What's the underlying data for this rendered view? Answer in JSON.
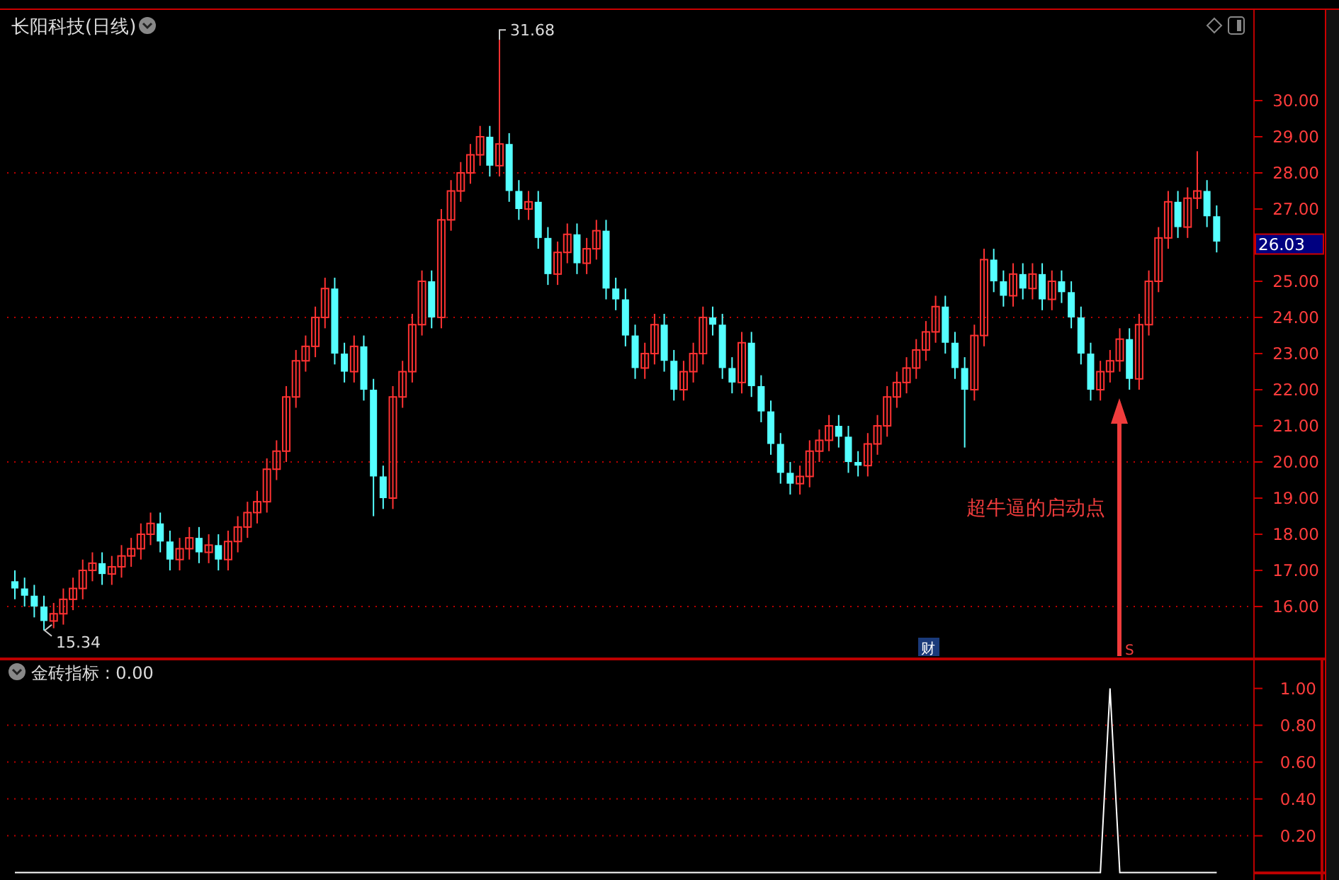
{
  "chart_title": "长阳科技(日线)",
  "chart_data": {
    "type": "candlestick",
    "ohlc": [
      [
        16.7,
        17.0,
        16.2,
        16.5
      ],
      [
        16.5,
        16.8,
        16.0,
        16.3
      ],
      [
        16.3,
        16.6,
        15.7,
        16.0
      ],
      [
        16.0,
        16.3,
        15.34,
        15.6
      ],
      [
        15.6,
        16.1,
        15.4,
        15.8
      ],
      [
        15.8,
        16.5,
        15.5,
        16.2
      ],
      [
        16.2,
        16.8,
        15.9,
        16.5
      ],
      [
        16.5,
        17.3,
        16.2,
        17.0
      ],
      [
        17.0,
        17.5,
        16.7,
        17.2
      ],
      [
        17.2,
        17.5,
        16.6,
        16.9
      ],
      [
        16.9,
        17.4,
        16.6,
        17.1
      ],
      [
        17.1,
        17.7,
        16.8,
        17.4
      ],
      [
        17.4,
        17.9,
        17.1,
        17.6
      ],
      [
        17.6,
        18.3,
        17.3,
        18.0
      ],
      [
        18.0,
        18.6,
        17.7,
        18.3
      ],
      [
        18.3,
        18.6,
        17.5,
        17.8
      ],
      [
        17.8,
        18.1,
        17.0,
        17.3
      ],
      [
        17.3,
        17.9,
        17.0,
        17.6
      ],
      [
        17.6,
        18.2,
        17.3,
        17.9
      ],
      [
        17.9,
        18.2,
        17.2,
        17.5
      ],
      [
        17.5,
        18.0,
        17.2,
        17.7
      ],
      [
        17.7,
        18.0,
        17.0,
        17.3
      ],
      [
        17.3,
        18.1,
        17.0,
        17.8
      ],
      [
        17.8,
        18.5,
        17.5,
        18.2
      ],
      [
        18.2,
        18.9,
        17.9,
        18.6
      ],
      [
        18.6,
        19.2,
        18.3,
        18.9
      ],
      [
        18.9,
        20.1,
        18.6,
        19.8
      ],
      [
        19.8,
        20.6,
        19.5,
        20.3
      ],
      [
        20.3,
        22.1,
        20.0,
        21.8
      ],
      [
        21.8,
        23.1,
        21.5,
        22.8
      ],
      [
        22.8,
        23.5,
        22.5,
        23.2
      ],
      [
        23.2,
        24.3,
        22.9,
        24.0
      ],
      [
        24.0,
        25.1,
        23.7,
        24.8
      ],
      [
        24.8,
        25.1,
        22.7,
        23.0
      ],
      [
        23.0,
        23.3,
        22.2,
        22.5
      ],
      [
        22.5,
        23.5,
        22.2,
        23.2
      ],
      [
        23.2,
        23.5,
        21.7,
        22.0
      ],
      [
        22.0,
        22.3,
        18.5,
        19.6
      ],
      [
        19.6,
        19.9,
        18.7,
        19.0
      ],
      [
        19.0,
        22.1,
        18.7,
        21.8
      ],
      [
        21.8,
        22.8,
        21.5,
        22.5
      ],
      [
        22.5,
        24.1,
        22.2,
        23.8
      ],
      [
        23.8,
        25.3,
        23.5,
        25.0
      ],
      [
        25.0,
        25.3,
        23.7,
        24.0
      ],
      [
        24.0,
        27.0,
        23.7,
        26.7
      ],
      [
        26.7,
        27.8,
        26.4,
        27.5
      ],
      [
        27.5,
        28.3,
        27.2,
        28.0
      ],
      [
        28.0,
        28.8,
        27.7,
        28.5
      ],
      [
        28.5,
        29.3,
        28.2,
        29.0
      ],
      [
        29.0,
        29.3,
        27.9,
        28.2
      ],
      [
        28.2,
        31.68,
        27.9,
        28.8
      ],
      [
        28.8,
        29.1,
        27.2,
        27.5
      ],
      [
        27.5,
        27.8,
        26.7,
        27.0
      ],
      [
        27.0,
        27.5,
        26.7,
        27.2
      ],
      [
        27.2,
        27.5,
        25.9,
        26.2
      ],
      [
        26.2,
        26.5,
        24.9,
        25.2
      ],
      [
        25.2,
        26.1,
        24.9,
        25.8
      ],
      [
        25.8,
        26.6,
        25.5,
        26.3
      ],
      [
        26.3,
        26.6,
        25.2,
        25.5
      ],
      [
        25.5,
        26.2,
        25.2,
        25.9
      ],
      [
        25.9,
        26.7,
        25.6,
        26.4
      ],
      [
        26.4,
        26.7,
        24.5,
        24.8
      ],
      [
        24.8,
        25.1,
        24.2,
        24.5
      ],
      [
        24.5,
        24.8,
        23.2,
        23.5
      ],
      [
        23.5,
        23.8,
        22.3,
        22.6
      ],
      [
        22.6,
        23.3,
        22.3,
        23.0
      ],
      [
        23.0,
        24.1,
        22.7,
        23.8
      ],
      [
        23.8,
        24.1,
        22.5,
        22.8
      ],
      [
        22.8,
        23.1,
        21.7,
        22.0
      ],
      [
        22.0,
        22.8,
        21.7,
        22.5
      ],
      [
        22.5,
        23.3,
        22.2,
        23.0
      ],
      [
        23.0,
        24.3,
        22.7,
        24.0
      ],
      [
        24.0,
        24.3,
        23.5,
        23.8
      ],
      [
        23.8,
        24.1,
        22.3,
        22.6
      ],
      [
        22.6,
        22.9,
        21.9,
        22.2
      ],
      [
        22.2,
        23.6,
        21.9,
        23.3
      ],
      [
        23.3,
        23.6,
        21.8,
        22.1
      ],
      [
        22.1,
        22.4,
        21.1,
        21.4
      ],
      [
        21.4,
        21.7,
        20.2,
        20.5
      ],
      [
        20.5,
        20.8,
        19.4,
        19.7
      ],
      [
        19.7,
        20.0,
        19.1,
        19.4
      ],
      [
        19.4,
        19.9,
        19.1,
        19.6
      ],
      [
        19.6,
        20.6,
        19.3,
        20.3
      ],
      [
        20.3,
        20.9,
        20.0,
        20.6
      ],
      [
        20.6,
        21.3,
        20.3,
        21.0
      ],
      [
        21.0,
        21.3,
        20.4,
        20.7
      ],
      [
        20.7,
        21.0,
        19.7,
        20.0
      ],
      [
        20.0,
        20.3,
        19.6,
        19.9
      ],
      [
        19.9,
        20.8,
        19.6,
        20.5
      ],
      [
        20.5,
        21.3,
        20.2,
        21.0
      ],
      [
        21.0,
        22.1,
        20.7,
        21.8
      ],
      [
        21.8,
        22.5,
        21.5,
        22.2
      ],
      [
        22.2,
        22.9,
        21.9,
        22.6
      ],
      [
        22.6,
        23.4,
        22.3,
        23.1
      ],
      [
        23.1,
        23.9,
        22.8,
        23.6
      ],
      [
        23.6,
        24.6,
        23.3,
        24.3
      ],
      [
        24.3,
        24.6,
        23.0,
        23.3
      ],
      [
        23.3,
        23.6,
        22.3,
        22.6
      ],
      [
        22.6,
        22.9,
        20.4,
        22.0
      ],
      [
        22.0,
        23.8,
        21.7,
        23.5
      ],
      [
        23.5,
        25.9,
        23.2,
        25.6
      ],
      [
        25.6,
        25.9,
        24.7,
        25.0
      ],
      [
        25.0,
        25.3,
        24.3,
        24.6
      ],
      [
        24.6,
        25.5,
        24.3,
        25.2
      ],
      [
        25.2,
        25.5,
        24.5,
        24.8
      ],
      [
        24.8,
        25.5,
        24.5,
        25.2
      ],
      [
        25.2,
        25.5,
        24.2,
        24.5
      ],
      [
        24.5,
        25.3,
        24.2,
        25.0
      ],
      [
        25.0,
        25.3,
        24.4,
        24.7
      ],
      [
        24.7,
        25.0,
        23.7,
        24.0
      ],
      [
        24.0,
        24.3,
        22.7,
        23.0
      ],
      [
        23.0,
        23.3,
        21.7,
        22.0
      ],
      [
        22.0,
        22.8,
        21.7,
        22.5
      ],
      [
        22.5,
        23.1,
        22.2,
        22.8
      ],
      [
        22.8,
        23.7,
        22.5,
        23.4
      ],
      [
        23.4,
        23.7,
        22.0,
        22.3
      ],
      [
        22.3,
        24.1,
        22.0,
        23.8
      ],
      [
        23.8,
        25.3,
        23.5,
        25.0
      ],
      [
        25.0,
        26.5,
        24.7,
        26.2
      ],
      [
        26.2,
        27.5,
        25.9,
        27.2
      ],
      [
        27.2,
        27.5,
        26.2,
        26.5
      ],
      [
        26.5,
        27.6,
        26.2,
        27.3
      ],
      [
        27.3,
        28.6,
        27.0,
        27.5
      ],
      [
        27.5,
        27.8,
        26.5,
        26.8
      ],
      [
        26.8,
        27.1,
        25.8,
        26.1
      ]
    ],
    "ylim": [
      14.55,
      32.51
    ],
    "grid": true,
    "yticks": [
      {
        "value": 30,
        "label": "30.00"
      },
      {
        "value": 29,
        "label": "29.00"
      },
      {
        "value": 28,
        "label": "28.00"
      },
      {
        "value": 27,
        "label": "27.00"
      },
      {
        "value": 25,
        "label": "25.00"
      },
      {
        "value": 24,
        "label": "24.00"
      },
      {
        "value": 23,
        "label": "23.00"
      },
      {
        "value": 22,
        "label": "22.00"
      },
      {
        "value": 21,
        "label": "21.00"
      },
      {
        "value": 20,
        "label": "20.00"
      },
      {
        "value": 19,
        "label": "19.00"
      },
      {
        "value": 18,
        "label": "18.00"
      },
      {
        "value": 17,
        "label": "17.00"
      },
      {
        "value": 16,
        "label": "16.00"
      }
    ]
  },
  "last_price": "26.03",
  "high_label": "31.68",
  "low_label": "15.34",
  "annotation": "超牛逼的启动点",
  "event_badge": "财",
  "signal_marker": "S",
  "indicator": {
    "label": "金砖指标 : 0.00",
    "chart_data": {
      "type": "line",
      "ylim": [
        -0.04,
        1.16
      ],
      "grid": true,
      "yticks": [
        {
          "value": 1,
          "label": "1.00"
        },
        {
          "value": 0.8,
          "label": "0.80"
        },
        {
          "value": 0.6,
          "label": "0.60"
        },
        {
          "value": 0.4,
          "label": "0.40"
        },
        {
          "value": 0.2,
          "label": "0.20"
        }
      ],
      "values": [
        0,
        0,
        0,
        0,
        0,
        0,
        0,
        0,
        0,
        0,
        0,
        0,
        0,
        0,
        0,
        0,
        0,
        0,
        0,
        0,
        0,
        0,
        0,
        0,
        0,
        0,
        0,
        0,
        0,
        0,
        0,
        0,
        0,
        0,
        0,
        0,
        0,
        0,
        0,
        0,
        0,
        0,
        0,
        0,
        0,
        0,
        0,
        0,
        0,
        0,
        0,
        0,
        0,
        0,
        0,
        0,
        0,
        0,
        0,
        0,
        0,
        0,
        0,
        0,
        0,
        0,
        0,
        0,
        0,
        0,
        0,
        0,
        0,
        0,
        0,
        0,
        0,
        0,
        0,
        0,
        0,
        0,
        0,
        0,
        0,
        0,
        0,
        0,
        0,
        0,
        0,
        0,
        0,
        0,
        0,
        0,
        0,
        0,
        0,
        0,
        0,
        0,
        0,
        0,
        0,
        0,
        0,
        0,
        0,
        0,
        0,
        0,
        0,
        1,
        0,
        0,
        0,
        0,
        0,
        0,
        0,
        0,
        0,
        0,
        0
      ]
    }
  }
}
